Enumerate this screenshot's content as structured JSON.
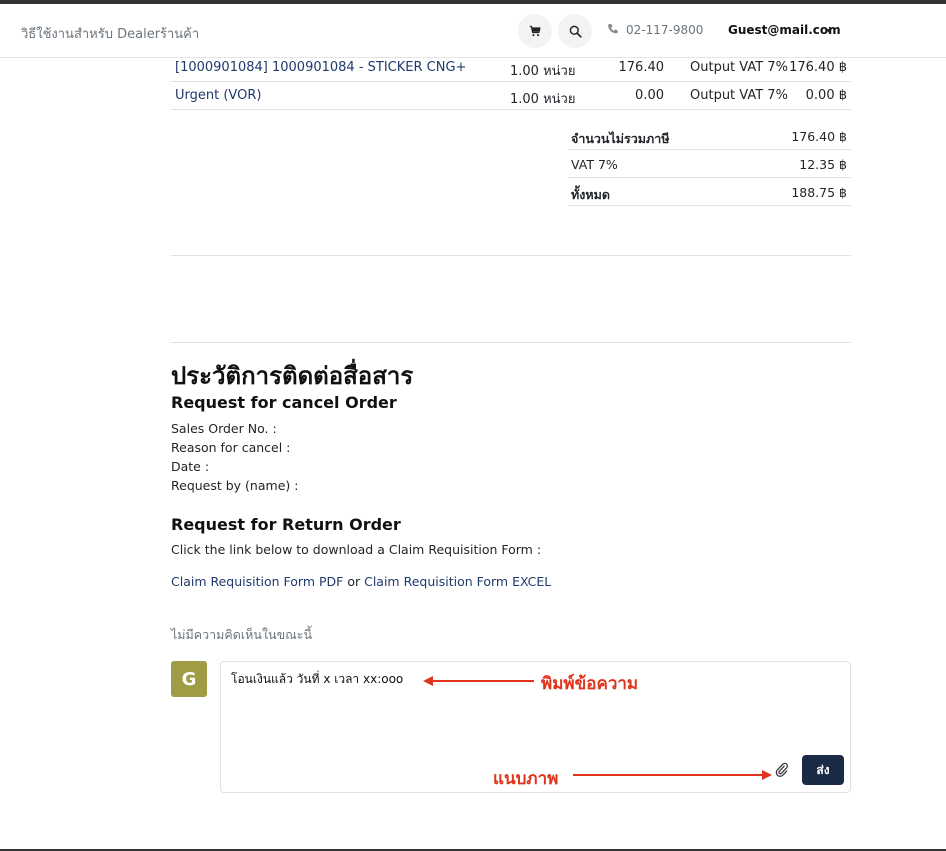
{
  "nav": {
    "links": [
      "วิธีใช้งานสำหรับ Dealer",
      "ร้านค้า"
    ],
    "phone": "02-117-9800",
    "user": "Guest@mail.com"
  },
  "order_lines": [
    {
      "name": "[1000901084] 1000901084 - STICKER CNG+",
      "qty": "1.00 หน่วย",
      "price": "176.40",
      "tax": "Output VAT 7%",
      "subtotal": "176.40 ฿"
    },
    {
      "name": "Urgent (VOR)",
      "qty": "1.00 หน่วย",
      "price": "0.00",
      "tax": "Output VAT 7%",
      "subtotal": "0.00 ฿"
    }
  ],
  "totals": [
    {
      "label": "จำนวนไม่รวมภาษี",
      "value": "176.40 ฿",
      "bold": true
    },
    {
      "label": "VAT 7%",
      "value": "12.35 ฿",
      "bold": false
    },
    {
      "label": "ทั้งหมด",
      "value": "188.75 ฿",
      "bold": true
    }
  ],
  "history": {
    "title": "ประวัติการติดต่อสื่อสาร",
    "cancel_heading": "Request for cancel Order",
    "cancel_fields": [
      "Sales Order No. :",
      "Reason for cancel :",
      "Date :",
      "Request by (name) :"
    ],
    "return_heading": "Request for Return Order",
    "return_text": "Click the link below to download a Claim Requisition Form :",
    "link_pdf": "Claim Requisition Form PDF",
    "link_or": " or ",
    "link_excel": "Claim Requisition Form EXCEL",
    "no_comments": "ไม่มีความคิดเห็นในขณะนี้"
  },
  "composer": {
    "avatar_letter": "G",
    "message_value": "โอนเงินแล้ว วันที่ x เวลา xx:ooo",
    "send_label": "ส่ง"
  },
  "annotations": {
    "type_message": "พิมพ์ข้อความ",
    "attach_image": "แนบภาพ",
    "color": "#e0341c"
  }
}
